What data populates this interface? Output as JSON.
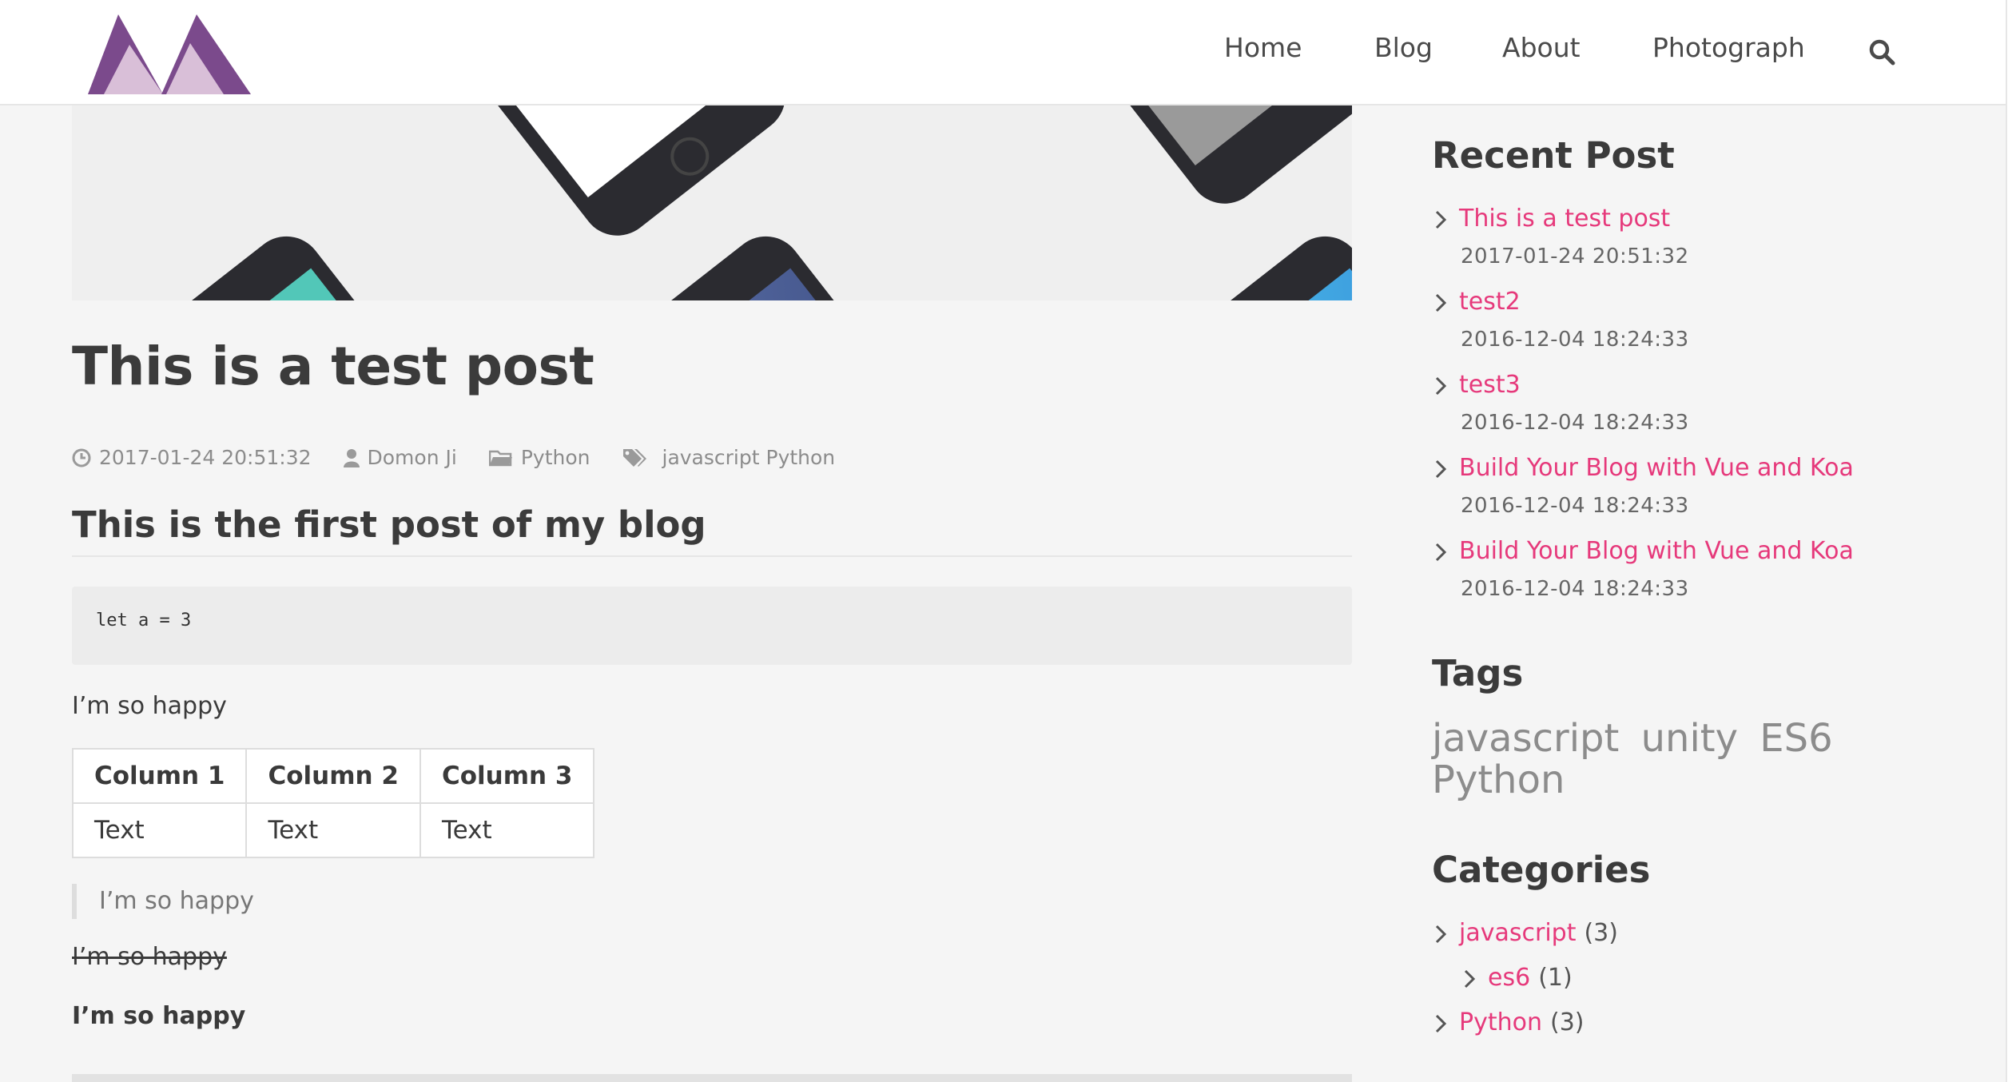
{
  "nav": {
    "items": [
      "Home",
      "Blog",
      "About",
      "Photograph"
    ]
  },
  "post": {
    "title": "This is a test post",
    "date": "2017-01-24 20:51:32",
    "author": "Domon Ji",
    "category": "Python",
    "tags": "javascript Python",
    "heading": "This is the first post of my blog",
    "code": "let a = 3",
    "paragraph": "I’m so happy",
    "table": {
      "headers": [
        "Column 1",
        "Column 2",
        "Column 3"
      ],
      "rows": [
        [
          "Text",
          "Text",
          "Text"
        ]
      ]
    },
    "blockquote": "I’m so happy",
    "strikethrough": "I’m so happy",
    "bold": "I’m so happy"
  },
  "sidebar": {
    "recent_heading": "Recent Post",
    "recent": [
      {
        "title": "This is a test post",
        "date": "2017-01-24 20:51:32"
      },
      {
        "title": "test2",
        "date": "2016-12-04 18:24:33"
      },
      {
        "title": "test3",
        "date": "2016-12-04 18:24:33"
      },
      {
        "title": "Build Your Blog with Vue and Koa",
        "date": "2016-12-04 18:24:33"
      },
      {
        "title": "Build Your Blog with Vue and Koa",
        "date": "2016-12-04 18:24:33"
      }
    ],
    "tags_heading": "Tags",
    "tags": [
      "javascript",
      "unity",
      "ES6",
      "Python"
    ],
    "categories_heading": "Categories",
    "categories": [
      {
        "name": "javascript",
        "count": "(3)"
      },
      {
        "name": "es6",
        "count": "(1)"
      },
      {
        "name": "Python",
        "count": "(3)"
      }
    ]
  },
  "colors": {
    "accent_link": "#e6397b",
    "logo_dark": "#7b4a8c",
    "logo_light": "#d9bfd8"
  },
  "icons": {
    "search": "search-icon",
    "clock": "clock-icon",
    "user": "user-icon",
    "folder": "folder-icon",
    "tags": "tags-icon",
    "chevron": "chevron-right-icon"
  }
}
